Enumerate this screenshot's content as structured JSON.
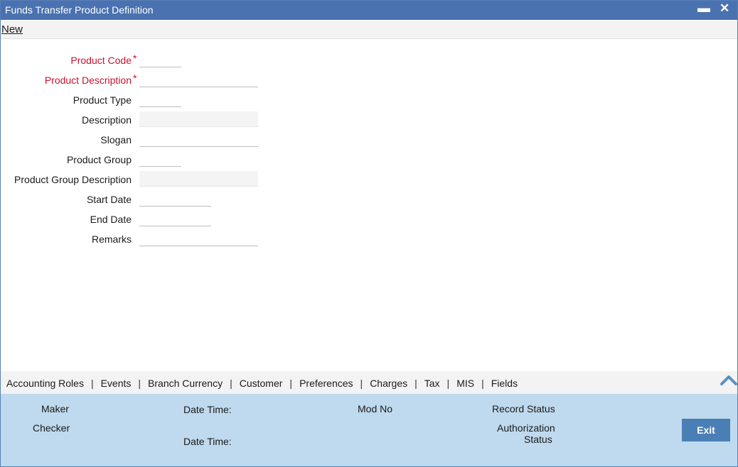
{
  "window": {
    "title": "Funds Transfer Product Definition",
    "minimize_glyph": "▬",
    "close_glyph": "✕"
  },
  "menu": {
    "new_label": "New"
  },
  "form": {
    "product_code": {
      "label": "Product Code",
      "required_mark": "*",
      "value": ""
    },
    "product_description": {
      "label": "Product Description",
      "required_mark": "*",
      "value": ""
    },
    "product_type": {
      "label": "Product Type",
      "value": ""
    },
    "description": {
      "label": "Description",
      "value": ""
    },
    "slogan": {
      "label": "Slogan",
      "value": ""
    },
    "product_group": {
      "label": "Product Group",
      "value": ""
    },
    "product_group_description": {
      "label": "Product Group Description",
      "value": ""
    },
    "start_date": {
      "label": "Start Date",
      "value": ""
    },
    "end_date": {
      "label": "End Date",
      "value": ""
    },
    "remarks": {
      "label": "Remarks",
      "value": ""
    }
  },
  "tabs": [
    "Accounting Roles",
    "Events",
    "Branch Currency",
    "Customer",
    "Preferences",
    "Charges",
    "Tax",
    "MIS",
    "Fields"
  ],
  "tab_separator": "|",
  "footer": {
    "maker": "Maker",
    "checker": "Checker",
    "date_time_1": "Date Time:",
    "date_time_2": "Date Time:",
    "mod_no": "Mod No",
    "record_status": "Record Status",
    "authorization_status_line1": "Authorization",
    "authorization_status_line2": "Status",
    "exit_label": "Exit"
  },
  "icons": {
    "collapse": "chevron-up-icon"
  },
  "colors": {
    "titlebar": "#4a72b0",
    "required": "#c8102e",
    "footer": "#bfd9ee",
    "exit_button": "#4a7fb5"
  }
}
